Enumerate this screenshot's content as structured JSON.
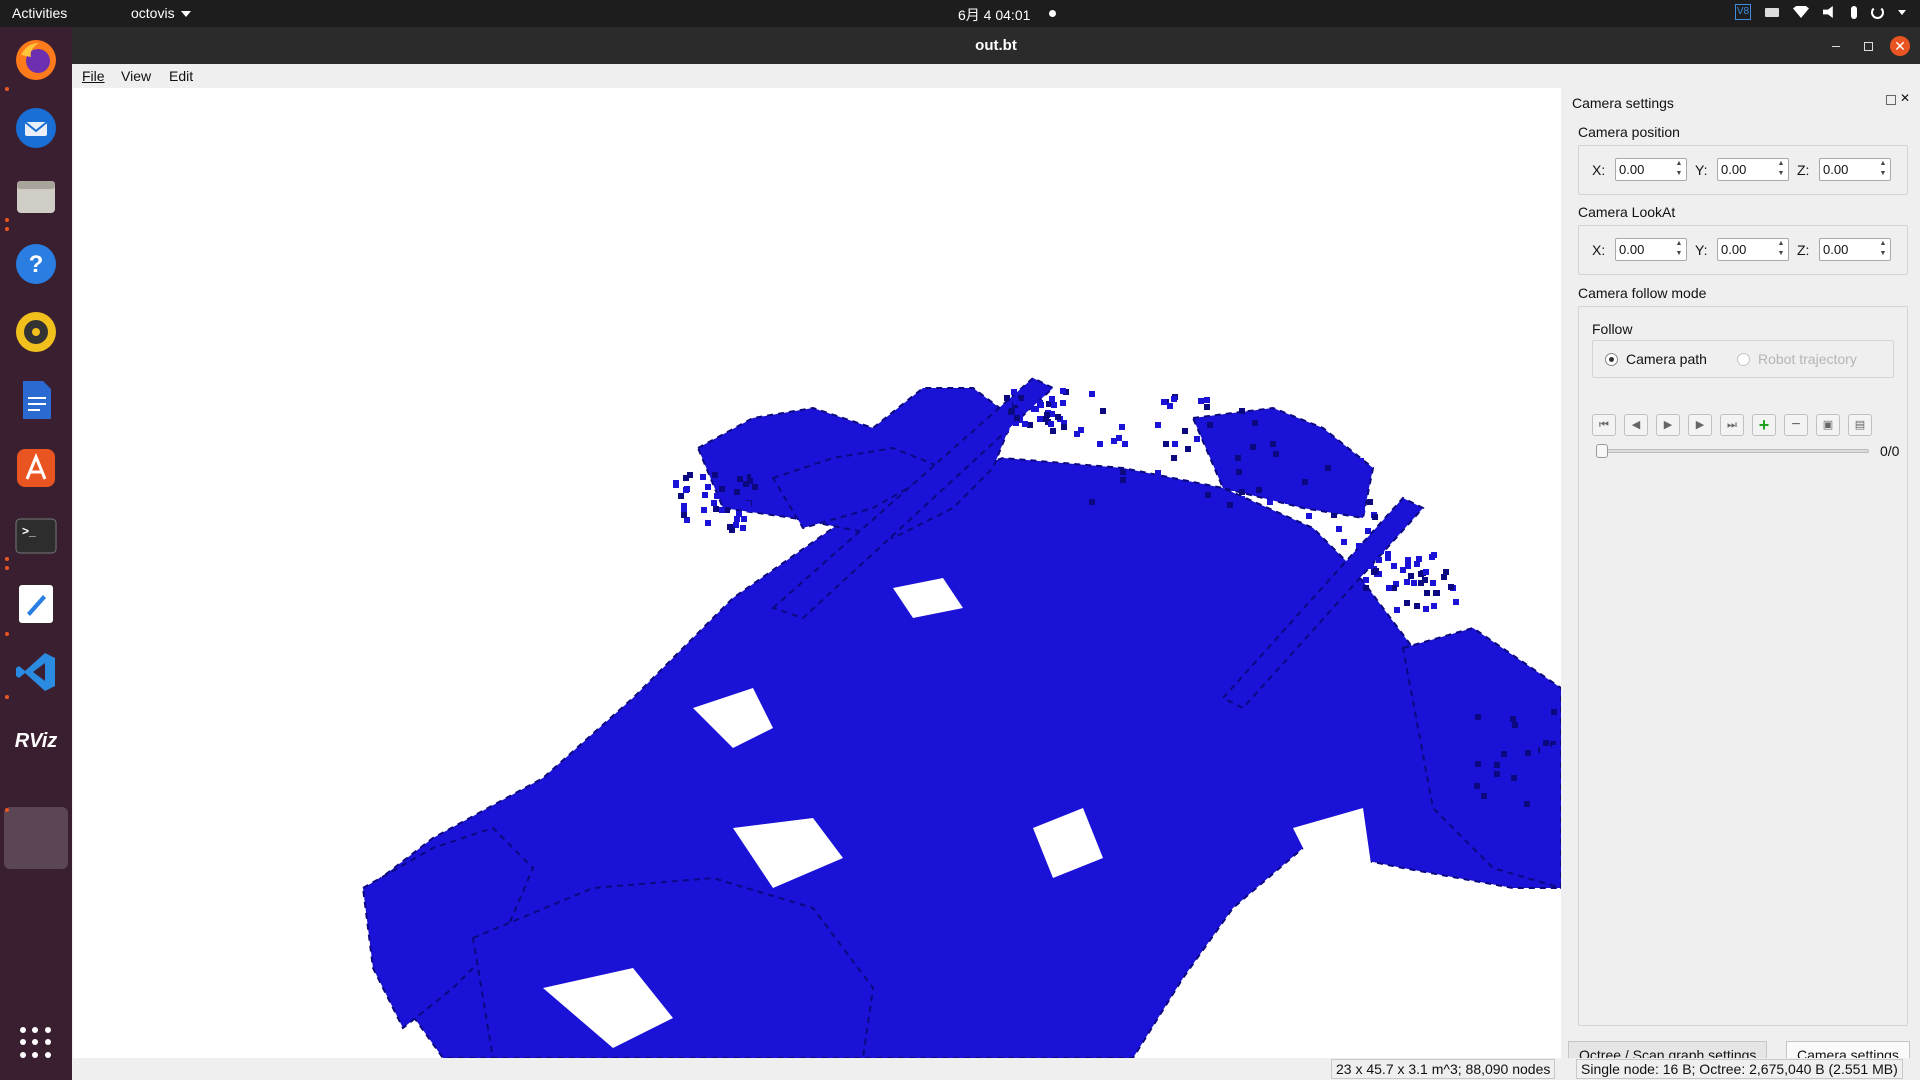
{
  "topbar": {
    "activities": "Activities",
    "app_name": "octovis",
    "clock": "6月 4  04:01",
    "tray_vs_label": "V8"
  },
  "dock": {
    "apps": [
      "firefox-icon",
      "thunderbird-icon",
      "files-icon",
      "help-icon",
      "rhythmbox-icon",
      "writer-icon",
      "app-center-icon",
      "terminal-icon",
      "text-editor-icon",
      "vscode-icon",
      "rviz-icon",
      "octovis-icon"
    ],
    "rviz_label": "RViz",
    "help_label": "?",
    "terminal_label": ">_"
  },
  "window": {
    "title": "out.bt"
  },
  "menu": {
    "file": "File",
    "view": "View",
    "edit": "Edit"
  },
  "panel": {
    "title": "Camera settings",
    "position": {
      "label": "Camera position",
      "x_label": "X:",
      "x": "0.00",
      "y_label": "Y:",
      "y": "0.00",
      "z_label": "Z:",
      "z": "0.00"
    },
    "lookat": {
      "label": "Camera LookAt",
      "x_label": "X:",
      "x": "0.00",
      "y_label": "Y:",
      "y": "0.00",
      "z_label": "Z:",
      "z": "0.00"
    },
    "follow_mode": {
      "label": "Camera follow mode",
      "follow_group": "Follow",
      "camera_path": "Camera path",
      "robot_trajectory": "Robot trajectory",
      "selected": "Camera path"
    },
    "playback": {
      "frame_counter": "0/0",
      "slider_value": 0
    }
  },
  "tabs": {
    "octree": "Octree / Scan graph settings",
    "camera": "Camera settings",
    "active": "Camera settings"
  },
  "status": {
    "dimensions": "23 x 45.7 x 3.1 m^3; 88,090 nodes",
    "memory": "Single node: 16 B; Octree: 2,675,040 B (2.551 MB)"
  },
  "colors": {
    "voxel": "#1a12d6",
    "voxel_dark": "#0c0880",
    "ubuntu_orange": "#e95420"
  }
}
